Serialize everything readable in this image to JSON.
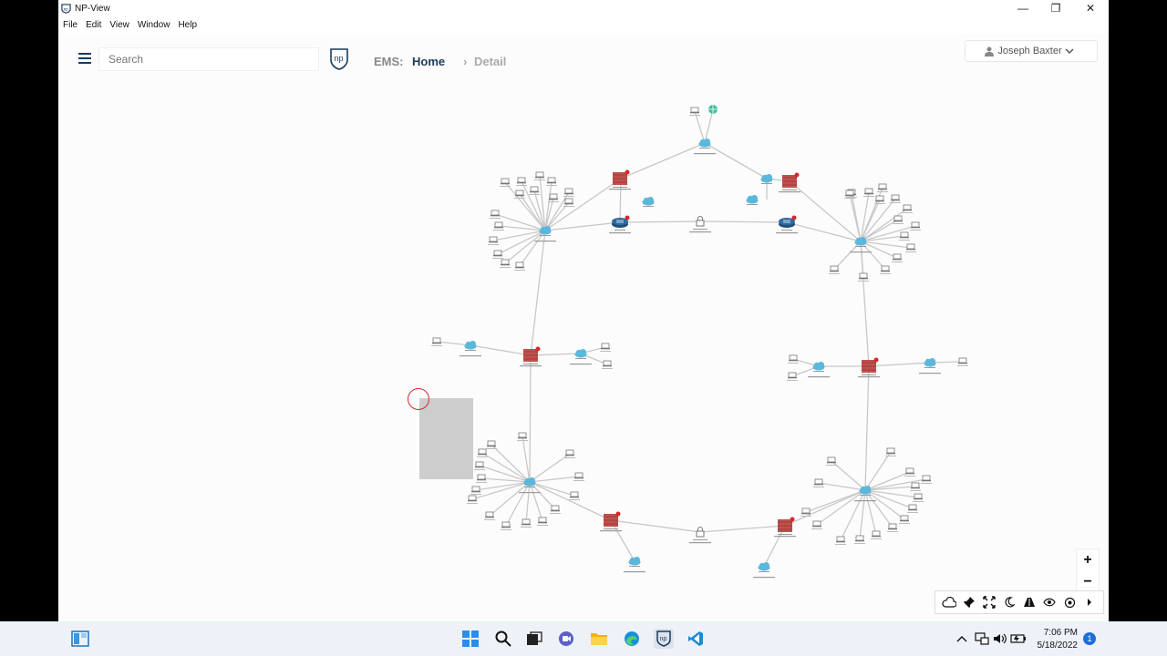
{
  "window": {
    "title": "NP-View",
    "app_icon": "np-view-icon"
  },
  "menu": [
    "File",
    "Edit",
    "View",
    "Window",
    "Help"
  ],
  "header": {
    "search_placeholder": "Search",
    "breadcrumb": {
      "prefix": "EMS:",
      "home": "Home",
      "current": "Detail"
    },
    "user": "Joseph Baxter"
  },
  "colors": {
    "firewall": "#c0504d",
    "router": "#2d6a9f",
    "cloud": "#5bb8dc",
    "alert": "#d9262c",
    "link": "#c8c8c8",
    "accent_nav": "#1b3a5b"
  },
  "zoom": {
    "in": "+",
    "out": "−"
  },
  "toolbar_icons": [
    "cloud-icon",
    "pin-icon",
    "fit-screen-icon",
    "dark-mode-icon",
    "path-icon",
    "eye-icon",
    "target-icon",
    "chevron-right-icon"
  ],
  "taskbar": {
    "apps": [
      "widgets-icon",
      "start-icon",
      "search-icon",
      "task-view-icon",
      "teams-chat-icon",
      "file-explorer-icon",
      "edge-icon",
      "np-view-taskbar-icon",
      "vscode-icon"
    ],
    "time": "7:06 PM",
    "date": "5/18/2022",
    "notification_count": "1"
  }
}
